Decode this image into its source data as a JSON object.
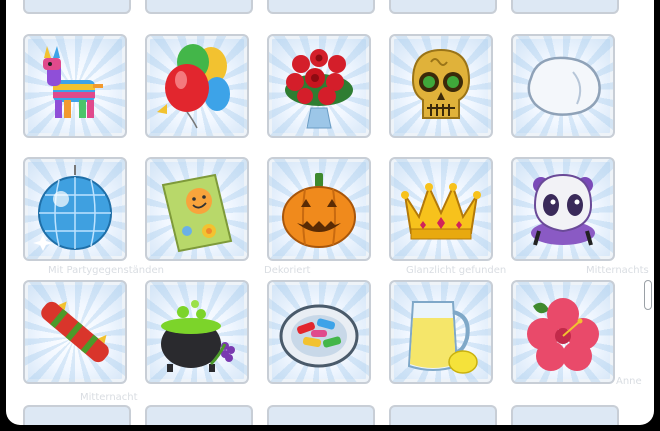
{
  "background_labels": {
    "row2": [
      "Mit Partygegenständen",
      "Dekoriert",
      "Glanzlicht gefunden",
      "Mitternachts"
    ],
    "row3": [
      "Mitternacht",
      "Anne"
    ]
  },
  "items": [
    {
      "name": "pinata",
      "icon": "pinata-icon"
    },
    {
      "name": "balloons",
      "icon": "balloons-icon"
    },
    {
      "name": "roses-bouquet",
      "icon": "roses-icon"
    },
    {
      "name": "sugar-skull",
      "icon": "sugar-skull-icon"
    },
    {
      "name": "pillow",
      "icon": "pillow-icon"
    },
    {
      "name": "disco-ball",
      "icon": "disco-ball-icon"
    },
    {
      "name": "greeting-card",
      "icon": "greeting-card-icon"
    },
    {
      "name": "jack-o-lantern",
      "icon": "jack-o-lantern-icon"
    },
    {
      "name": "crown",
      "icon": "crown-icon"
    },
    {
      "name": "ghost-mask",
      "icon": "ghost-mask-icon"
    },
    {
      "name": "christmas-cracker",
      "icon": "cracker-icon"
    },
    {
      "name": "cauldron",
      "icon": "cauldron-icon"
    },
    {
      "name": "candy-plate",
      "icon": "candy-plate-icon"
    },
    {
      "name": "lemonade",
      "icon": "lemonade-icon"
    },
    {
      "name": "hibiscus",
      "icon": "hibiscus-icon"
    }
  ]
}
